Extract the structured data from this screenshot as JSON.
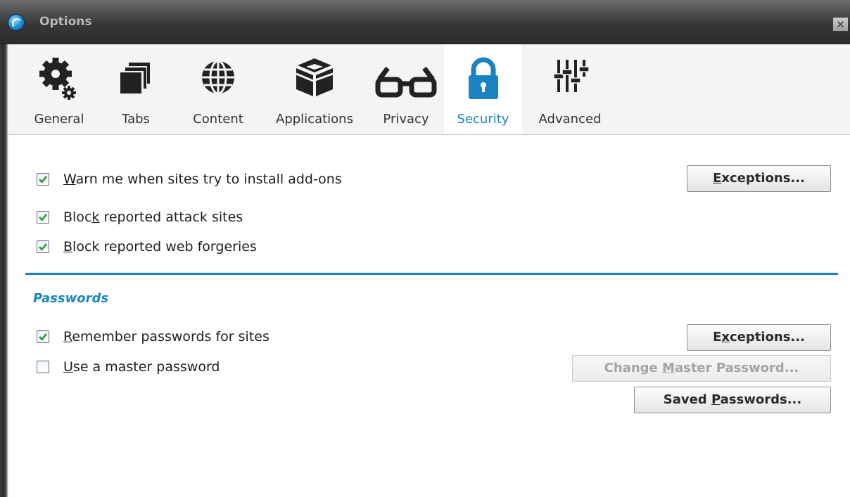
{
  "window": {
    "title": "Options",
    "close_symbol": "✕"
  },
  "toolbar": {
    "tabs": [
      {
        "label": "General",
        "icon": "gear-icon"
      },
      {
        "label": "Tabs",
        "icon": "tabs-icon"
      },
      {
        "label": "Content",
        "icon": "globe-icon"
      },
      {
        "label": "Applications",
        "icon": "box-icon"
      },
      {
        "label": "Privacy",
        "icon": "glasses-icon"
      },
      {
        "label": "Security",
        "icon": "lock-icon",
        "active": true
      },
      {
        "label": "Advanced",
        "icon": "sliders-icon"
      }
    ]
  },
  "security": {
    "addons": {
      "pre": "",
      "key": "W",
      "post": "arn me when sites try to install add-ons",
      "checked": true
    },
    "addons_exceptions": {
      "pre": "",
      "key": "E",
      "post": "xceptions..."
    },
    "attack": {
      "pre": "Bloc",
      "key": "k",
      "post": " reported attack sites",
      "checked": true
    },
    "forgeries": {
      "pre": "",
      "key": "B",
      "post": "lock reported web forgeries",
      "checked": true
    }
  },
  "passwords": {
    "heading": "Passwords",
    "remember": {
      "pre": "",
      "key": "R",
      "post": "emember passwords for sites",
      "checked": true
    },
    "remember_exceptions": {
      "pre": "E",
      "key": "x",
      "post": "ceptions..."
    },
    "master": {
      "pre": "",
      "key": "U",
      "post": "se a master password",
      "checked": false
    },
    "change_master": {
      "pre": "Change ",
      "key": "M",
      "post": "aster Password...",
      "disabled": true
    },
    "saved": {
      "pre": "Saved ",
      "key": "P",
      "post": "asswords..."
    }
  },
  "colors": {
    "accent": "#1a84c1",
    "check": "#2d9c3c"
  }
}
